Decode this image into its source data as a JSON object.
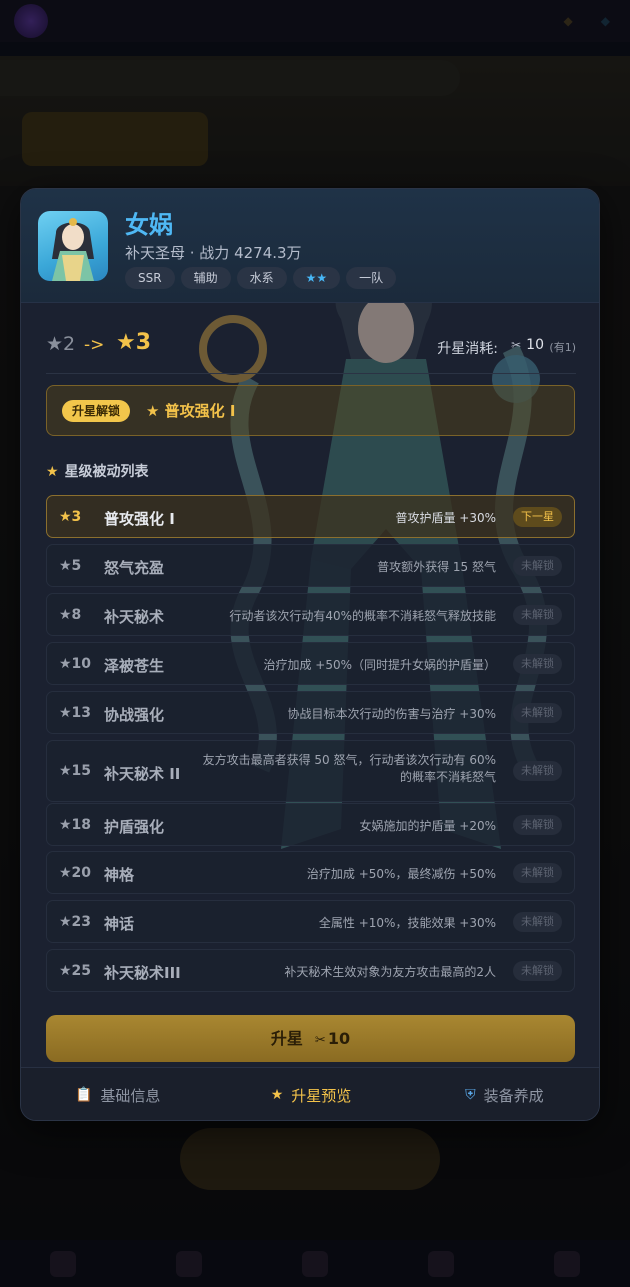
{
  "hero": {
    "name": "女娲",
    "subtitle": "补天圣母 · 战力 4274.3万",
    "tags": [
      "SSR",
      "辅助",
      "水系",
      "★★",
      "一队"
    ]
  },
  "star_upgrade": {
    "from": "★2",
    "arrow": "->",
    "to": "★3",
    "cost_label": "升星消耗:",
    "cost_value": "10",
    "cost_owned": "(有1)"
  },
  "unlock": {
    "badge": "升星解锁",
    "text": "★ 普攻强化 I"
  },
  "passive_list": {
    "title": "星级被动列表",
    "rows": [
      {
        "star": "★3",
        "name": "普攻强化 I",
        "desc": "普攻护盾量 +30%",
        "status": "下一星",
        "active": true
      },
      {
        "star": "★5",
        "name": "怒气充盈",
        "desc": "普攻额外获得 15 怒气",
        "status": "未解锁"
      },
      {
        "star": "★8",
        "name": "补天秘术",
        "desc": "行动者该次行动有40%的概率不消耗怒气释放技能",
        "status": "未解锁"
      },
      {
        "star": "★10",
        "name": "泽被苍生",
        "desc": "治疗加成 +50%（同时提升女娲的护盾量）",
        "status": "未解锁"
      },
      {
        "star": "★13",
        "name": "协战强化",
        "desc": "协战目标本次行动的伤害与治疗 +30%",
        "status": "未解锁"
      },
      {
        "star": "★15",
        "name": "补天秘术 II",
        "desc": "友方攻击最高者获得 50 怒气，行动者该次行动有 60% 的概率不消耗怒气",
        "status": "未解锁",
        "tall": true
      },
      {
        "star": "★18",
        "name": "护盾强化",
        "desc": "女娲施加的护盾量 +20%",
        "status": "未解锁"
      },
      {
        "star": "★20",
        "name": "神格",
        "desc": "治疗加成 +50%，最终减伤 +50%",
        "status": "未解锁"
      },
      {
        "star": "★23",
        "name": "神话",
        "desc": "全属性 +10%，技能效果 +30%",
        "status": "未解锁"
      },
      {
        "star": "★25",
        "name": "补天秘术III",
        "desc": "补天秘术生效对象为友方攻击最高的2人",
        "status": "未解锁"
      }
    ]
  },
  "upgrade_button": {
    "label": "升星",
    "cost": "10"
  },
  "tabs": [
    {
      "label": "基础信息",
      "icon": "clipboard-icon"
    },
    {
      "label": "升星预览",
      "icon": "star-icon",
      "active": true
    },
    {
      "label": "装备养成",
      "icon": "shield-icon"
    }
  ],
  "colors": {
    "accent_gold": "#f3c24a",
    "hero_name_blue": "#4fb8f4",
    "panel_bg": "#1b2130"
  }
}
